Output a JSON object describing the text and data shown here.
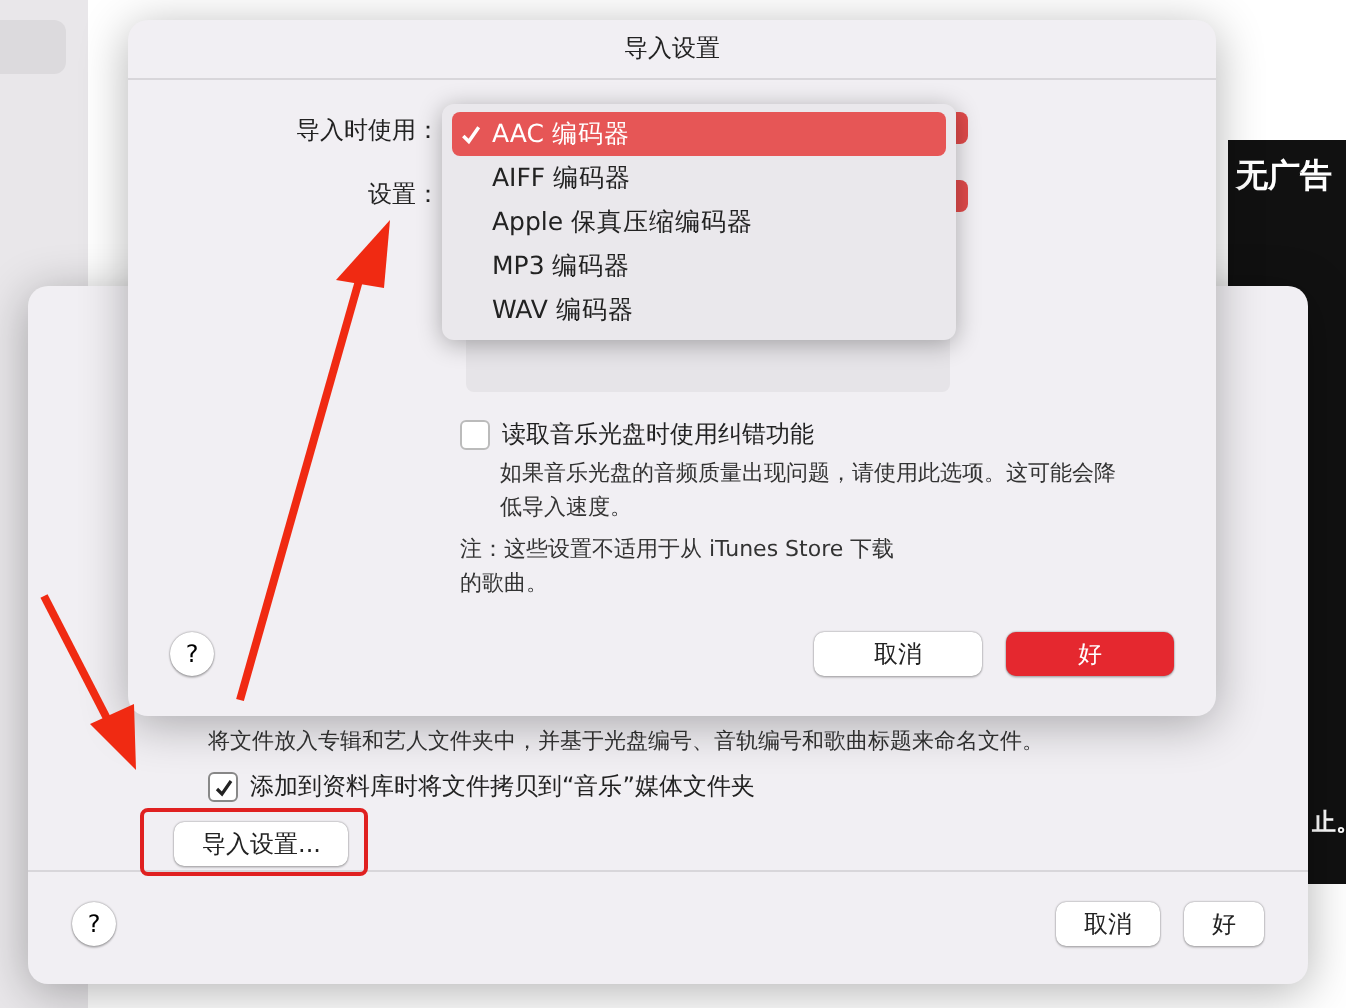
{
  "background": {
    "side_text": "无广告",
    "side_text_2": "止。"
  },
  "prefs_window": {
    "description": "将文件放入专辑和艺人文件夹中，并基于光盘编号、音轨编号和歌曲标题来命名文件。",
    "copy_option": {
      "label": "添加到资料库时将文件拷贝到“音乐”媒体文件夹",
      "checked": true
    },
    "import_button": "导入设置...",
    "help": "?",
    "buttons": [
      {
        "label": "取消",
        "primary": false
      },
      {
        "label": "好",
        "primary": false
      }
    ]
  },
  "import_dialog": {
    "title": "导入设置",
    "import_using_label": "导入时使用：",
    "setting_label": "设置：",
    "menu": [
      {
        "label": "AAC 编码器",
        "selected": true
      },
      {
        "label": "AIFF 编码器",
        "selected": false
      },
      {
        "label": "Apple 保真压缩编码器",
        "selected": false
      },
      {
        "label": "MP3 编码器",
        "selected": false
      },
      {
        "label": "WAV 编码器",
        "selected": false
      }
    ],
    "error_correction": {
      "label": "读取音乐光盘时使用纠错功能",
      "checked": false,
      "hint": "如果音乐光盘的音频质量出现问题，请使用此选项。这可能会降低导入速度。"
    },
    "note": "注：这些设置不适用于从 iTunes Store 下载的歌曲。",
    "help": "?",
    "buttons": [
      {
        "label": "取消",
        "primary": false
      },
      {
        "label": "好",
        "primary": true
      }
    ]
  }
}
